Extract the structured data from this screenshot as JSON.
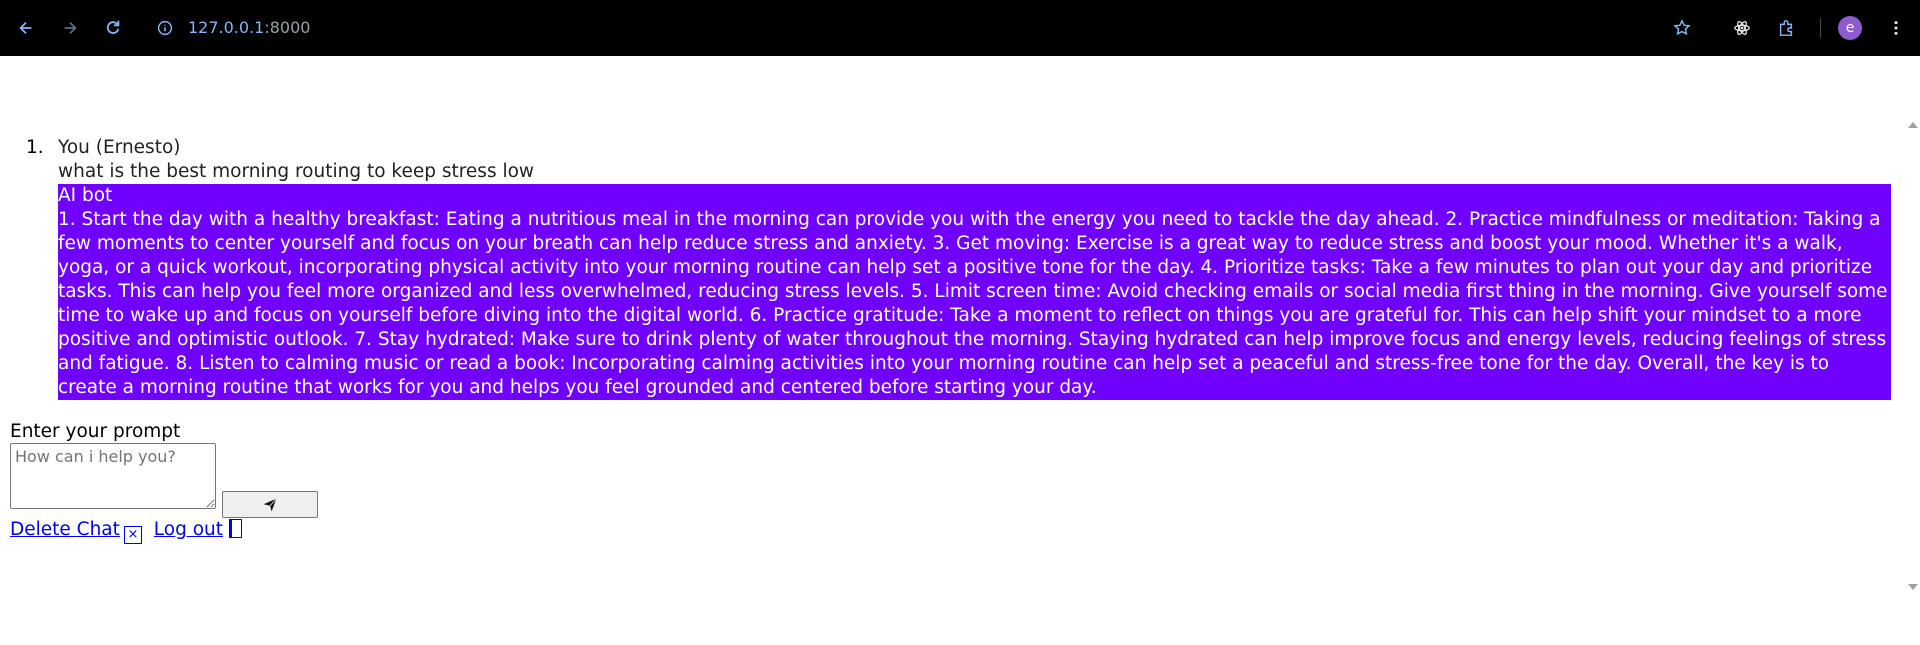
{
  "browser": {
    "url_host": "127.0.0.1",
    "url_port": ":8000",
    "avatar_letter": "e"
  },
  "chat": {
    "messages": [
      {
        "number": "1.",
        "user_label": "You (Ernesto)",
        "user_text": "what is the best morning routing to keep stress low",
        "bot_label": "AI bot",
        "bot_text": "1. Start the day with a healthy breakfast: Eating a nutritious meal in the morning can provide you with the energy you need to tackle the day ahead. 2. Practice mindfulness or meditation: Taking a few moments to center yourself and focus on your breath can help reduce stress and anxiety. 3. Get moving: Exercise is a great way to reduce stress and boost your mood. Whether it's a walk, yoga, or a quick workout, incorporating physical activity into your morning routine can help set a positive tone for the day. 4. Prioritize tasks: Take a few minutes to plan out your day and prioritize tasks. This can help you feel more organized and less overwhelmed, reducing stress levels. 5. Limit screen time: Avoid checking emails or social media first thing in the morning. Give yourself some time to wake up and focus on yourself before diving into the digital world. 6. Practice gratitude: Take a moment to reflect on things you are grateful for. This can help shift your mindset to a more positive and optimistic outlook. 7. Stay hydrated: Make sure to drink plenty of water throughout the morning. Staying hydrated can help improve focus and energy levels, reducing feelings of stress and fatigue. 8. Listen to calming music or read a book: Incorporating calming activities into your morning routine can help set a peaceful and stress-free tone for the day. Overall, the key is to create a morning routine that works for you and helps you feel grounded and centered before starting your day."
      }
    ]
  },
  "prompt": {
    "label": "Enter your prompt",
    "placeholder": "How can i help you?"
  },
  "links": {
    "delete_chat": "Delete Chat",
    "delete_icon_glyph": "×",
    "log_out": "Log out"
  },
  "colors": {
    "bot_background": "#7000ff",
    "link": "#0000ee",
    "chrome_background": "#000000"
  }
}
